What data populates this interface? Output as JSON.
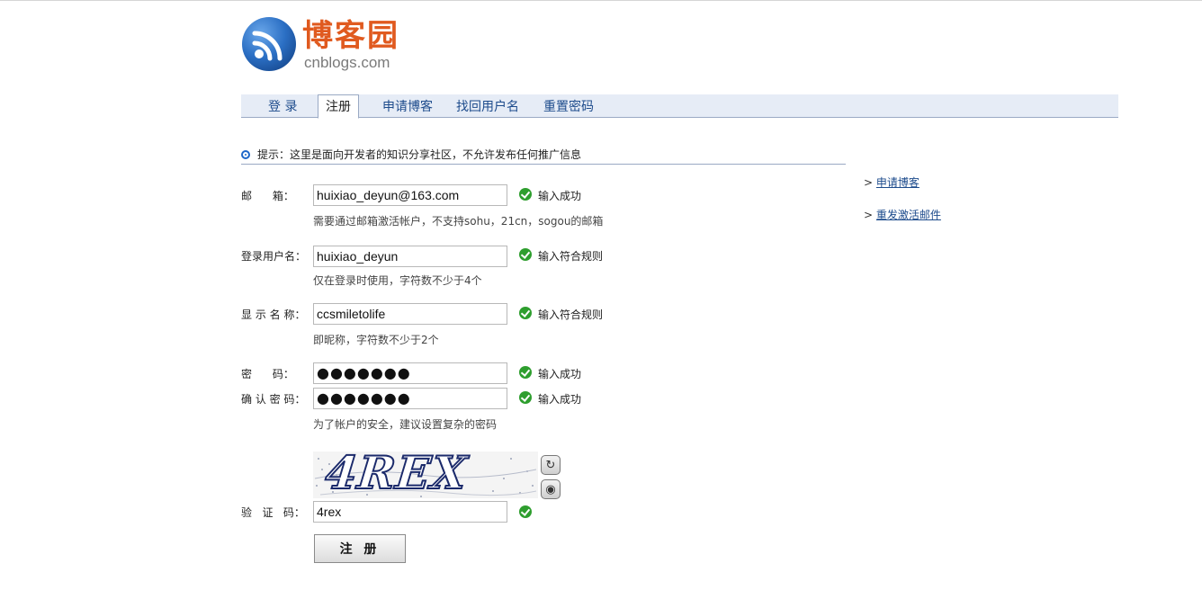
{
  "logo": {
    "cn": "博客园",
    "en": "cnblogs.com",
    "icon": "rss-feed-icon",
    "brand_color": "#e05a1f"
  },
  "nav": {
    "items": [
      "登 录",
      "注册",
      "申请博客",
      "找回用户名",
      "重置密码"
    ],
    "active": "注册"
  },
  "tip": "提示：这里是面向开发者的知识分享社区，不允许发布任何推广信息",
  "form": {
    "email": {
      "label": "邮      箱：",
      "value": "huixiao_deyun@163.com",
      "status": "输入成功",
      "hint": "需要通过邮箱激活帐户，不支持sohu，21cn，sogou的邮箱"
    },
    "username": {
      "label": "登录用户名：",
      "value": "huixiao_deyun",
      "status": "输入符合规则",
      "hint": "仅在登录时使用，字符数不少于4个"
    },
    "display_name": {
      "label": "显 示 名 称：",
      "value": "ccsmiletolife",
      "status": "输入符合规则",
      "hint": "即昵称，字符数不少于2个"
    },
    "password": {
      "label": "密      码：",
      "value": "●●●●●●●",
      "status": "输入成功"
    },
    "confirm_password": {
      "label": "确 认 密 码：",
      "value": "●●●●●●●",
      "status": "输入成功",
      "hint": "为了帐户的安全，建议设置复杂的密码"
    },
    "captcha": {
      "label": "验   证   码：",
      "image_text": "4REX",
      "value": "4rex"
    },
    "submit_label": "注 册"
  },
  "sidebar": {
    "prefix": ">",
    "links": [
      "申请博客",
      "重发激活邮件"
    ]
  },
  "colors": {
    "nav_bg": "#e6ecf6",
    "link": "#1d4b8c",
    "success": "#2e9e2e"
  }
}
